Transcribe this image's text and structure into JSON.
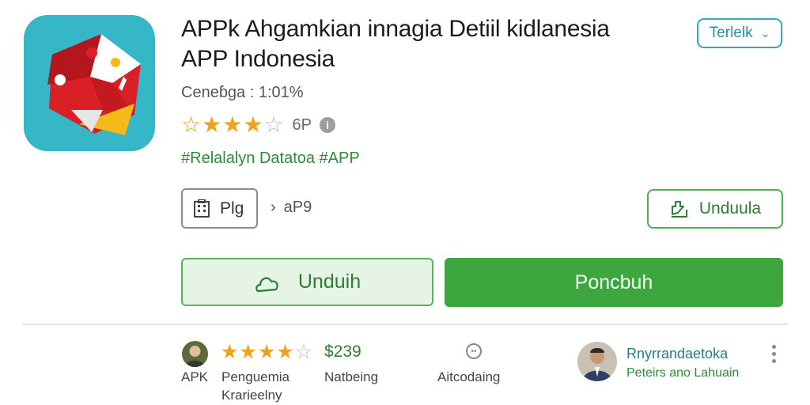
{
  "app": {
    "title_line1": "APPk Ahgamkian innagia Detiil kidlanesia",
    "title_line2": "APP Indonesia",
    "genre": "Ceneɓga : 1:01%",
    "rating_value": 3.5,
    "rating_max": 5,
    "rating_count": "6P",
    "tagline": "#Relalalyn Datatoa #APP",
    "icon_name": "app-logo-icon"
  },
  "header": {
    "language_select": "Terlelk"
  },
  "meta": {
    "package_label": "Plg",
    "crumb_value": "aP9"
  },
  "actions": {
    "download_outline": "Unduula",
    "download_light": "Unduih",
    "primary": "Poncbuh"
  },
  "footer": {
    "left_label": "APK",
    "rating_value": 4,
    "rating_max": 5,
    "price": "$239",
    "category_line1": "Penguemia",
    "category_line2": "Krarieelny",
    "status_label": "Natbeing",
    "extra_label": "Aitcodaing",
    "developer_name": "Rnyrrandaetoka",
    "developer_sub": "Peteirs ano Lahuain"
  },
  "colors": {
    "accent_green": "#3da63f",
    "light_green": "#e6f4e6",
    "teal": "#3aa7b6",
    "star": "#f0a21a"
  }
}
